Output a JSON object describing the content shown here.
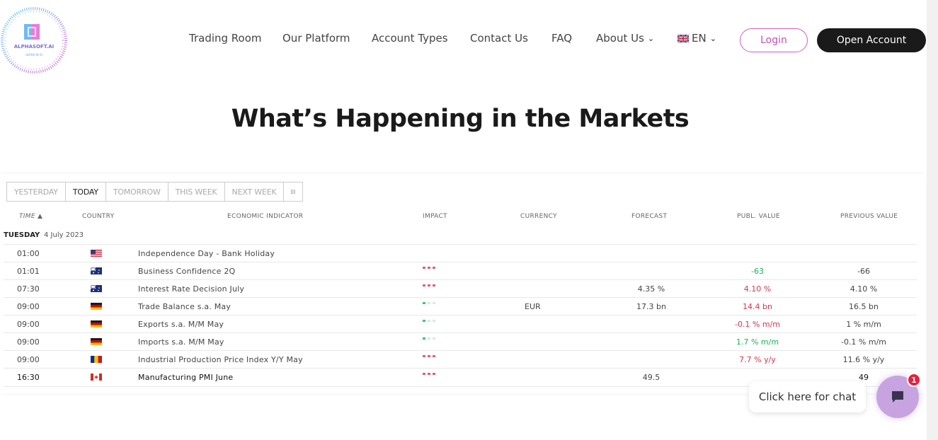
{
  "header": {
    "logo_text": "ALPHASOFT.AI",
    "logo_subtext": "ALPHA W AI",
    "nav": [
      {
        "label": "Trading Room"
      },
      {
        "label": "Our Platform"
      },
      {
        "label": "Account Types"
      },
      {
        "label": "Contact Us"
      },
      {
        "label": "FAQ"
      },
      {
        "label": "About Us",
        "dropdown": true
      }
    ],
    "language": "EN",
    "login_label": "Login",
    "open_account_label": "Open Account"
  },
  "page_title": "What’s Happening in the Markets",
  "calendar": {
    "tabs": [
      "YESTERDAY",
      "TODAY",
      "TOMORROW",
      "THIS WEEK",
      "NEXT WEEK"
    ],
    "active_tab": "TODAY",
    "columns": {
      "time": "TIME ▲",
      "country": "COUNTRY",
      "indicator": "ECONOMIC INDICATOR",
      "impact": "IMPACT",
      "currency": "CURRENCY",
      "forecast": "FORECAST",
      "publ_value": "PUBL. VALUE",
      "previous_value": "PREVIOUS VALUE"
    },
    "day_label": "TUESDAY",
    "day_date": "4 July 2023",
    "rows": [
      {
        "time": "01:00",
        "country": "US",
        "indicator": "Independence Day - Bank Holiday",
        "impact": "none",
        "currency": "",
        "forecast": "",
        "publ": "",
        "publ_dir": "",
        "previous": ""
      },
      {
        "time": "01:01",
        "country": "AU",
        "indicator": "Business Confidence 2Q",
        "impact": "high",
        "currency": "",
        "forecast": "",
        "publ": "-63",
        "publ_dir": "pos",
        "previous": "-66"
      },
      {
        "time": "07:30",
        "country": "AU",
        "indicator": "Interest Rate Decision July",
        "impact": "high",
        "currency": "",
        "forecast": "4.35 %",
        "publ": "4.10 %",
        "publ_dir": "neg",
        "previous": "4.10 %"
      },
      {
        "time": "09:00",
        "country": "DE",
        "indicator": "Trade Balance s.a. May",
        "impact": "low",
        "currency": "EUR",
        "forecast": "17.3 bn",
        "publ": "14.4 bn",
        "publ_dir": "neg",
        "previous": "16.5 bn"
      },
      {
        "time": "09:00",
        "country": "DE",
        "indicator": "Exports s.a. M/M May",
        "impact": "low",
        "currency": "",
        "forecast": "",
        "publ": "-0.1 % m/m",
        "publ_dir": "neg",
        "previous": "1 % m/m"
      },
      {
        "time": "09:00",
        "country": "DE",
        "indicator": "Imports s.a. M/M May",
        "impact": "low",
        "currency": "",
        "forecast": "",
        "publ": "1.7 % m/m",
        "publ_dir": "pos",
        "previous": "-0.1 % m/m"
      },
      {
        "time": "09:00",
        "country": "RO",
        "indicator": "Industrial Production Price Index Y/Y May",
        "impact": "high",
        "currency": "",
        "forecast": "",
        "publ": "7.7 % y/y",
        "publ_dir": "neg",
        "previous": "11.6 % y/y"
      },
      {
        "time": "16:30",
        "country": "CA",
        "indicator": "Manufacturing PMI June",
        "impact": "high",
        "currency": "",
        "forecast": "49.5",
        "publ": "",
        "publ_dir": "",
        "previous": "49"
      }
    ]
  },
  "chat": {
    "prompt": "Click here for chat",
    "badge_count": "1"
  },
  "colors": {
    "positive": "#19b25a",
    "negative": "#d9334d",
    "accent_pink": "#c44eb6",
    "dark_button": "#1a1a1a",
    "chat_purple": "#c7a4e0"
  }
}
